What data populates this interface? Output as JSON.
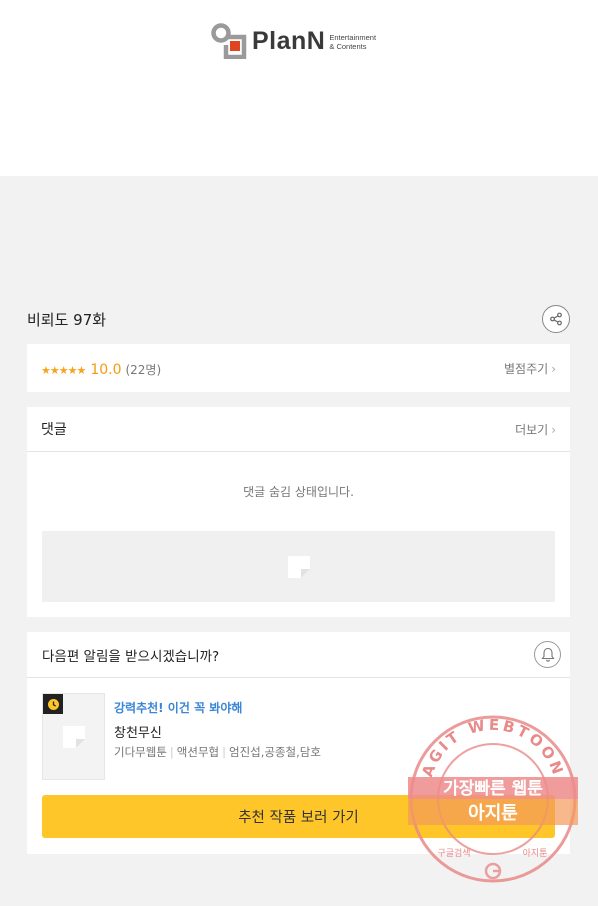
{
  "brand": {
    "name_main": "PlanN",
    "name_sub_line1": "Entertainment",
    "name_sub_line2": "& Contents",
    "accent_color": "#e0451f"
  },
  "episode": {
    "title": "비뢰도 97화",
    "share_icon": "share-icon"
  },
  "rating": {
    "stars": "★★★★★",
    "score": "10.0",
    "count": "(22명)",
    "rate_link": "별점주기",
    "star_color": "#f7a41d"
  },
  "comments": {
    "label": "댓글",
    "more_link": "더보기",
    "hidden_message": "댓글 숨김 상태입니다."
  },
  "notify": {
    "question": "다음편 알림을 받으시겠습니까?",
    "bell_icon": "bell-icon"
  },
  "recommendation": {
    "tag": "강력추천! 이건 꼭 봐야해",
    "title": "창천무신",
    "genre": "기다무웹툰",
    "sub_genre": "액션무협",
    "authors": "엄진섭,공종철,담호",
    "tag_color": "#3a86d6",
    "cta_label": "추천 작품 보러 가기",
    "cta_color": "#ffc629"
  },
  "watermark": {
    "ring_text": "AGIT WEBTOON",
    "line1": "가장빠른 웹툰",
    "line2": "아지툰",
    "bottom_left": "구글검색",
    "bottom_right": "아지툰"
  }
}
